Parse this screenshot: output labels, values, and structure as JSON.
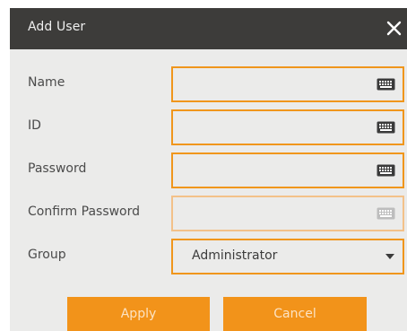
{
  "dialog": {
    "title": "Add User",
    "close_icon": "close-x-icon"
  },
  "fields": {
    "name": {
      "label": "Name",
      "value": "",
      "icon": "keyboard-icon"
    },
    "id": {
      "label": "ID",
      "value": "",
      "icon": "keyboard-icon"
    },
    "password": {
      "label": "Password",
      "value": "",
      "icon": "keyboard-icon"
    },
    "confirm_password": {
      "label": "Confirm Password",
      "value": "",
      "icon": "keyboard-icon",
      "disabled": true
    },
    "group": {
      "label": "Group",
      "selected": "Administrator",
      "icon": "chevron-down-icon"
    }
  },
  "buttons": {
    "apply": "Apply",
    "cancel": "Cancel"
  },
  "colors": {
    "accent": "#f2931a",
    "titlebar": "#3d3c3a",
    "background": "#ebebea"
  }
}
